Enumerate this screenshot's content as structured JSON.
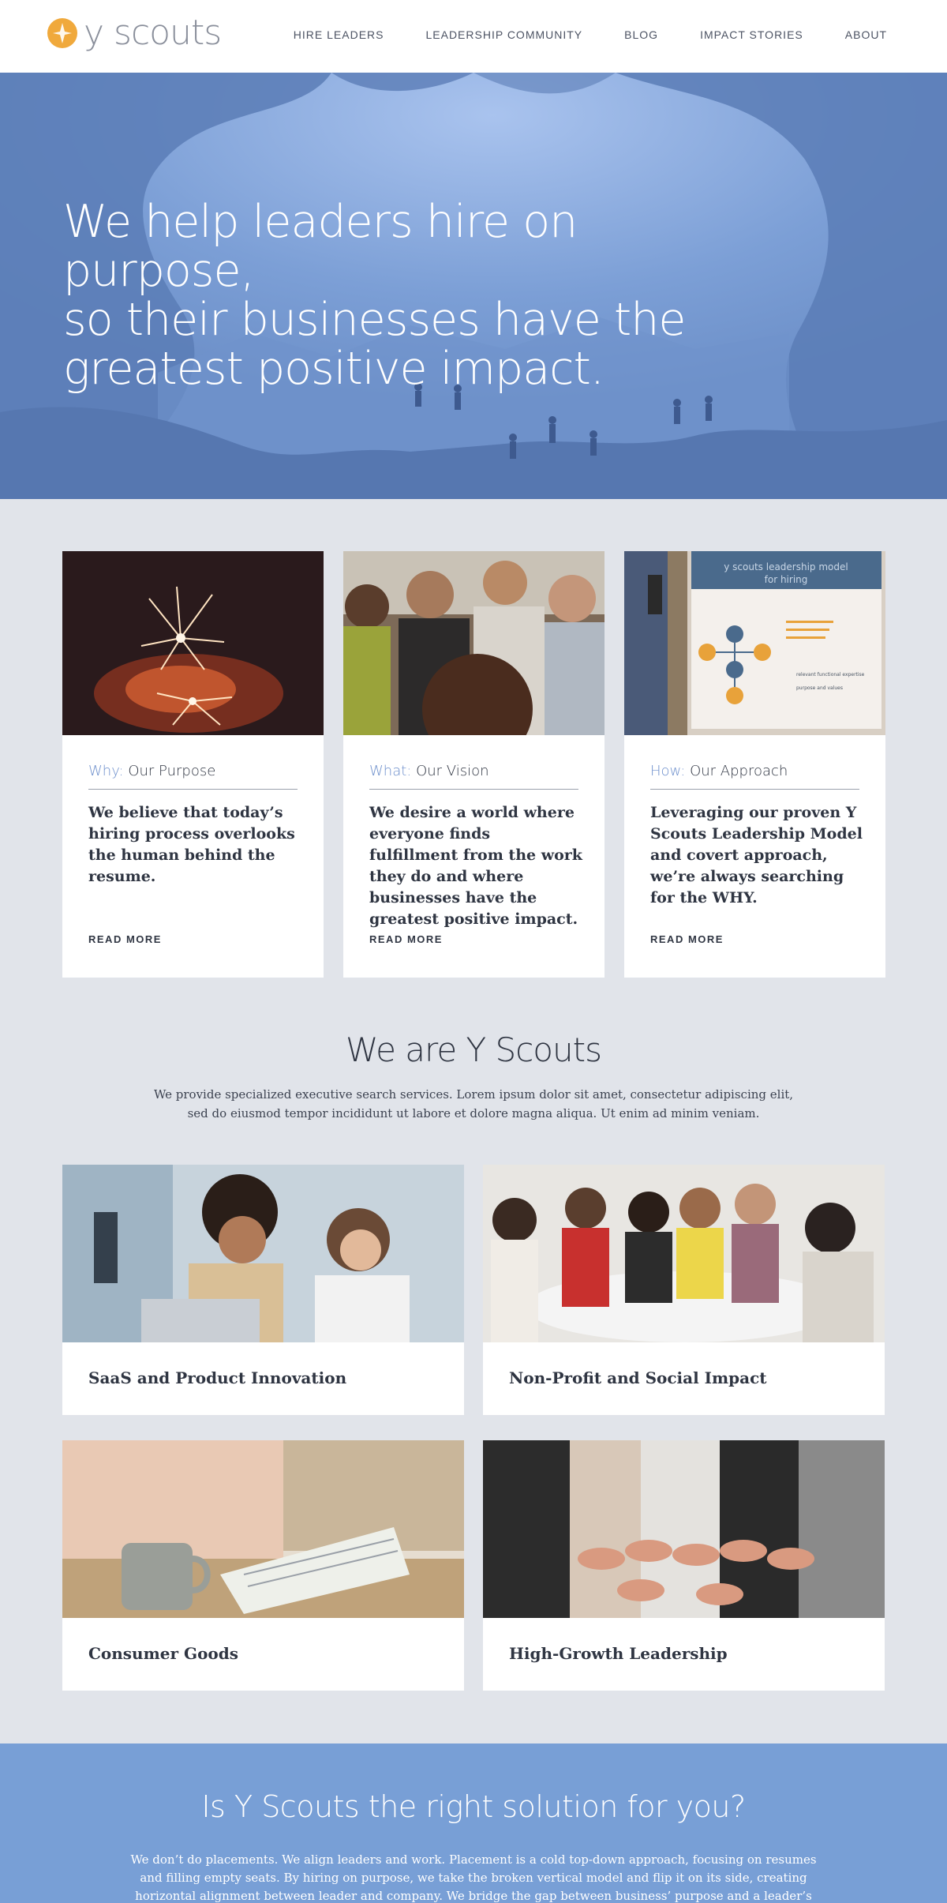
{
  "brand": {
    "name": "y scouts",
    "accent": "#f0a93c"
  },
  "nav": [
    {
      "label": "HIRE LEADERS"
    },
    {
      "label": "LEADERSHIP COMMUNITY"
    },
    {
      "label": "BLOG"
    },
    {
      "label": "IMPACT STORIES"
    },
    {
      "label": "ABOUT"
    }
  ],
  "hero": {
    "line1": "We help leaders hire on purpose,",
    "line2": "so their businesses have the",
    "line3": "greatest positive impact."
  },
  "cards": [
    {
      "pre": "Why:",
      "label": "Our Purpose",
      "body": "We believe that today’s hiring process overlooks the human behind the resume.",
      "more": "READ MORE"
    },
    {
      "pre": "What:",
      "label": "Our Vision",
      "body": "We desire a world where everyone finds fulfillment from the work they do and where businesses have the greatest positive impact.",
      "more": "READ MORE"
    },
    {
      "pre": "How:",
      "label": "Our Approach",
      "body": "Leveraging our proven Y Scouts Leadership Model and covert approach, we’re always searching for the WHY.",
      "more": "READ MORE"
    }
  ],
  "poster": {
    "line1": "y scouts leadership model",
    "line2": "for hiring",
    "item1": "relevant functional expertise",
    "item2": "purpose and values"
  },
  "about": {
    "title": "We are Y Scouts",
    "text": "We provide specialized executive search services. Lorem ipsum dolor sit amet, consectetur adipiscing elit, sed do eiusmod tempor incididunt ut labore et dolore magna aliqua. Ut enim ad minim veniam."
  },
  "industries": [
    {
      "title": "SaaS and Product Innovation"
    },
    {
      "title": "Non-Profit and Social Impact"
    },
    {
      "title": "Consumer Goods"
    },
    {
      "title": "High-Growth Leadership"
    }
  ],
  "cta": {
    "title": "Is Y Scouts the right solution for you?",
    "text": "We don’t do placements. We align leaders and work. Placement is a cold top-down approach, focusing on resumes and filling empty seats. By hiring on purpose, we take the broken vertical model and flip it on its side, creating horizontal alignment between leader and company. We bridge the gap between business’ purpose and a leader’s passions and strengths. It is"
  }
}
